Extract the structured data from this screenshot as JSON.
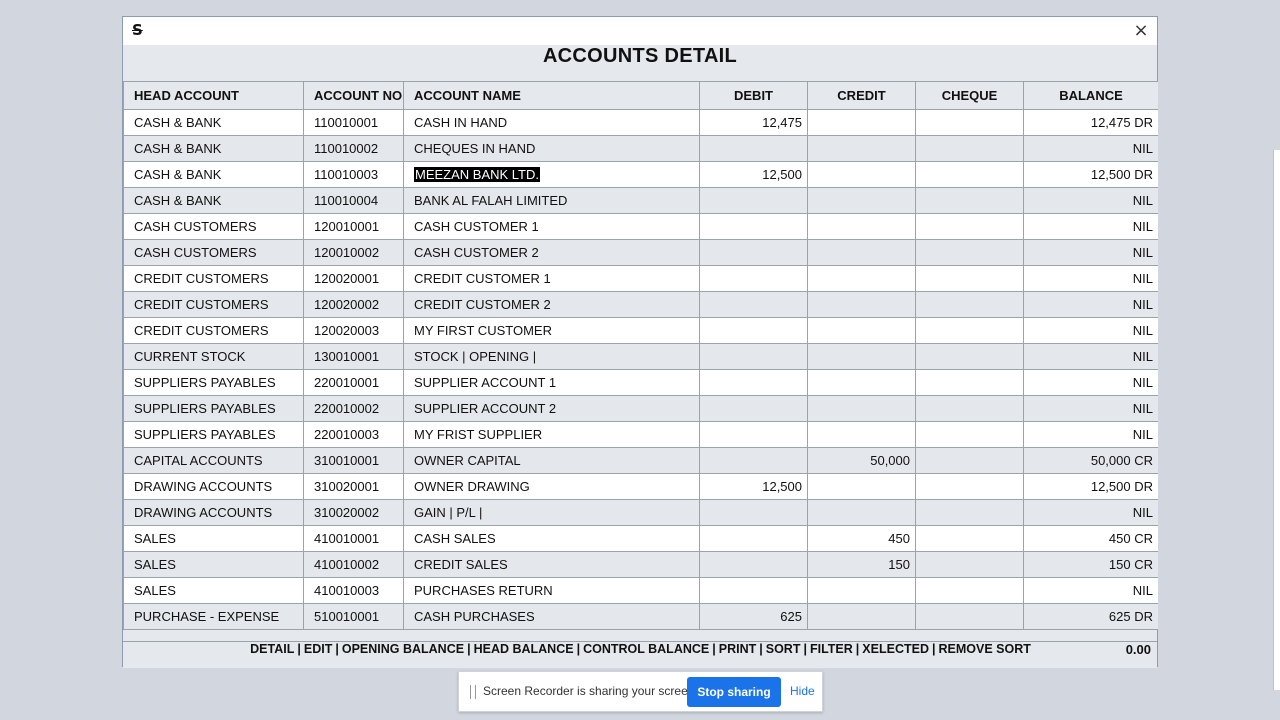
{
  "window": {
    "title": "ACCOUNTS DETAIL",
    "close_glyph": "×",
    "app_icon_glyph": "S"
  },
  "columns": [
    "HEAD ACCOUNT",
    "ACCOUNT NO.",
    "ACCOUNT NAME",
    "DEBIT",
    "CREDIT",
    "CHEQUE",
    "BALANCE"
  ],
  "rows": [
    {
      "head": "CASH & BANK",
      "no": "110010001",
      "name": "CASH IN HAND",
      "debit": "12,475",
      "credit": "",
      "cheque": "",
      "balance": "12,475 DR"
    },
    {
      "head": "CASH & BANK",
      "no": "110010002",
      "name": "CHEQUES IN HAND",
      "debit": "",
      "credit": "",
      "cheque": "",
      "balance": "NIL"
    },
    {
      "head": "CASH & BANK",
      "no": "110010003",
      "name": "MEEZAN BANK LTD.",
      "debit": "12,500",
      "credit": "",
      "cheque": "",
      "balance": "12,500 DR",
      "selected": true
    },
    {
      "head": "CASH & BANK",
      "no": "110010004",
      "name": "BANK AL FALAH LIMITED",
      "debit": "",
      "credit": "",
      "cheque": "",
      "balance": "NIL"
    },
    {
      "head": "CASH CUSTOMERS",
      "no": "120010001",
      "name": "CASH CUSTOMER 1",
      "debit": "",
      "credit": "",
      "cheque": "",
      "balance": "NIL"
    },
    {
      "head": "CASH CUSTOMERS",
      "no": "120010002",
      "name": "CASH CUSTOMER 2",
      "debit": "",
      "credit": "",
      "cheque": "",
      "balance": "NIL"
    },
    {
      "head": "CREDIT CUSTOMERS",
      "no": "120020001",
      "name": "CREDIT CUSTOMER 1",
      "debit": "",
      "credit": "",
      "cheque": "",
      "balance": "NIL"
    },
    {
      "head": "CREDIT CUSTOMERS",
      "no": "120020002",
      "name": "CREDIT CUSTOMER 2",
      "debit": "",
      "credit": "",
      "cheque": "",
      "balance": "NIL"
    },
    {
      "head": "CREDIT CUSTOMERS",
      "no": "120020003",
      "name": "MY FIRST CUSTOMER",
      "debit": "",
      "credit": "",
      "cheque": "",
      "balance": "NIL"
    },
    {
      "head": "CURRENT STOCK",
      "no": "130010001",
      "name": "STOCK | OPENING |",
      "debit": "",
      "credit": "",
      "cheque": "",
      "balance": "NIL"
    },
    {
      "head": "SUPPLIERS PAYABLES",
      "no": "220010001",
      "name": "SUPPLIER ACCOUNT 1",
      "debit": "",
      "credit": "",
      "cheque": "",
      "balance": "NIL"
    },
    {
      "head": "SUPPLIERS PAYABLES",
      "no": "220010002",
      "name": "SUPPLIER ACCOUNT 2",
      "debit": "",
      "credit": "",
      "cheque": "",
      "balance": "NIL"
    },
    {
      "head": "SUPPLIERS PAYABLES",
      "no": "220010003",
      "name": "MY FRIST SUPPLIER",
      "debit": "",
      "credit": "",
      "cheque": "",
      "balance": "NIL"
    },
    {
      "head": "CAPITAL ACCOUNTS",
      "no": "310010001",
      "name": "OWNER CAPITAL",
      "debit": "",
      "credit": "50,000",
      "cheque": "",
      "balance": "50,000 CR"
    },
    {
      "head": "DRAWING ACCOUNTS",
      "no": "310020001",
      "name": "OWNER DRAWING",
      "debit": "12,500",
      "credit": "",
      "cheque": "",
      "balance": "12,500 DR"
    },
    {
      "head": "DRAWING ACCOUNTS",
      "no": "310020002",
      "name": "GAIN | P/L |",
      "debit": "",
      "credit": "",
      "cheque": "",
      "balance": "NIL"
    },
    {
      "head": "SALES",
      "no": "410010001",
      "name": "CASH SALES",
      "debit": "",
      "credit": "450",
      "cheque": "",
      "balance": "450 CR"
    },
    {
      "head": "SALES",
      "no": "410010002",
      "name": "CREDIT SALES",
      "debit": "",
      "credit": "150",
      "cheque": "",
      "balance": "150 CR"
    },
    {
      "head": "SALES",
      "no": "410010003",
      "name": "PURCHASES RETURN",
      "debit": "",
      "credit": "",
      "cheque": "",
      "balance": "NIL"
    },
    {
      "head": "PURCHASE - EXPENSE",
      "no": "510010001",
      "name": "CASH PURCHASES",
      "debit": "625",
      "credit": "",
      "cheque": "",
      "balance": "625 DR"
    }
  ],
  "footer": {
    "menu": [
      "DETAIL",
      "EDIT",
      "OPENING BALANCE",
      "HEAD BALANCE",
      "CONTROL BALANCE",
      "PRINT",
      "SORT",
      "FILTER",
      "XELECTED",
      "REMOVE SORT"
    ],
    "separator": "|",
    "total": "0.00"
  },
  "share_bar": {
    "message": "Screen Recorder is sharing your screen.",
    "stop_label": "Stop sharing",
    "hide_label": "Hide"
  },
  "colors": {
    "window_bg": "#e5e8ec",
    "row_alt": "#e4e7eb",
    "selection": "#000000",
    "stop_button": "#1a73e8"
  }
}
